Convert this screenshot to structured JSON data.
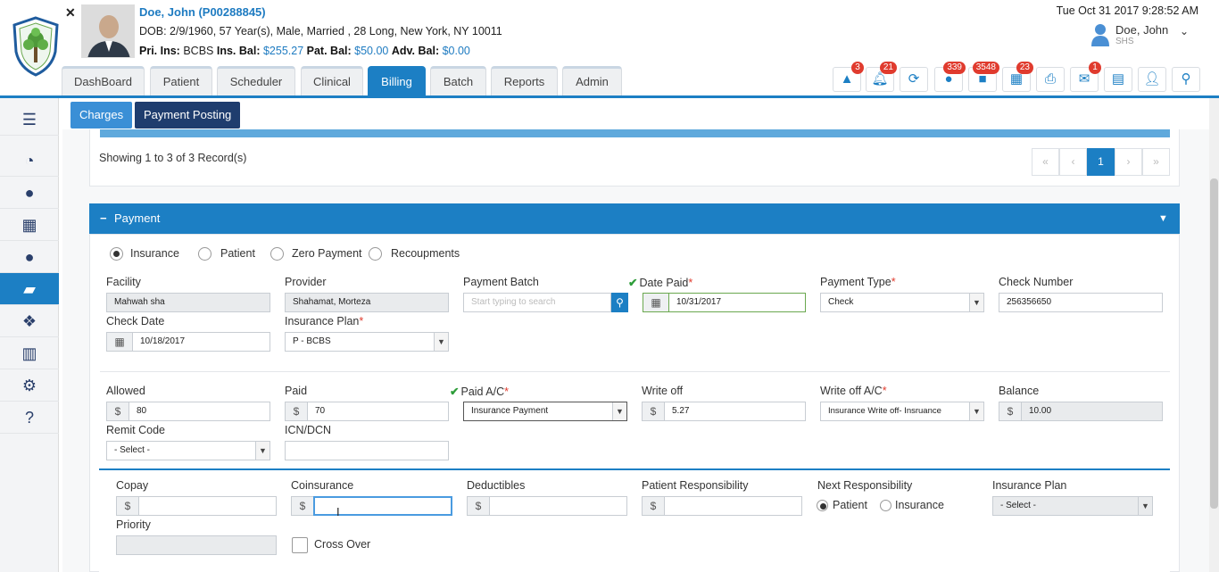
{
  "patient": {
    "name": "Doe, John (P00288845)",
    "demographics": "DOB: 2/9/1960, 57 Year(s), Male, Married , 28 Long, New York, NY 10011",
    "pri_ins_label": "Pri. Ins:",
    "pri_ins_value": "BCBS",
    "ins_bal_label": "Ins. Bal:",
    "ins_bal_value": "$255.27",
    "pat_bal_label": "Pat. Bal:",
    "pat_bal_value": "$50.00",
    "adv_bal_label": "Adv. Bal:",
    "adv_bal_value": "$0.00"
  },
  "datetime": "Tue Oct 31 2017 9:28:52 AM",
  "user": {
    "name": "Doe, John",
    "org": "SHS"
  },
  "tabs": [
    "DashBoard",
    "Patient",
    "Scheduler",
    "Clinical",
    "Billing",
    "Batch",
    "Reports",
    "Admin"
  ],
  "toolbar": {
    "badges": [
      "3",
      "21",
      "339",
      "3548",
      "23",
      "1"
    ]
  },
  "subtabs": [
    "Charges",
    "Payment Posting"
  ],
  "records": {
    "showing": "Showing 1 to 3 of 3 Record(s)",
    "current_page": "1"
  },
  "payment": {
    "section_title": "Payment",
    "payer_types": [
      "Insurance",
      "Patient",
      "Zero Payment",
      "Recoupments"
    ],
    "facility": {
      "label": "Facility",
      "value": "Mahwah sha"
    },
    "provider": {
      "label": "Provider",
      "value": "Shahamat, Morteza"
    },
    "payment_batch": {
      "label": "Payment Batch",
      "placeholder": "Start typing to search"
    },
    "date_paid": {
      "label": "Date Paid",
      "value": "10/31/2017"
    },
    "payment_type": {
      "label": "Payment Type",
      "value": "Check"
    },
    "check_number": {
      "label": "Check Number",
      "value": "256356650"
    },
    "check_date": {
      "label": "Check Date",
      "value": "10/18/2017"
    },
    "insurance_plan": {
      "label": "Insurance Plan",
      "value": "P - BCBS"
    },
    "allowed": {
      "label": "Allowed",
      "value": "80"
    },
    "paid": {
      "label": "Paid",
      "value": "70"
    },
    "paid_ac": {
      "label": "Paid A/C",
      "value": "Insurance Payment"
    },
    "write_off": {
      "label": "Write off",
      "value": "5.27"
    },
    "write_off_ac": {
      "label": "Write off A/C",
      "value": "Insurance Write off- Insruance"
    },
    "balance": {
      "label": "Balance",
      "value": "10.00"
    },
    "remit_code": {
      "label": "Remit Code",
      "value": "- Select -"
    },
    "icn_dcn": {
      "label": "ICN/DCN",
      "value": ""
    },
    "currency": "$"
  },
  "responsibility": {
    "copay": {
      "label": "Copay",
      "value": ""
    },
    "coinsurance": {
      "label": "Coinsurance",
      "value": ""
    },
    "deductibles": {
      "label": "Deductibles",
      "value": ""
    },
    "patient_responsibility": {
      "label": "Patient Responsibility",
      "value": ""
    },
    "next_responsibility": {
      "label": "Next Responsibility",
      "options": [
        "Patient",
        "Insurance"
      ]
    },
    "insurance_plan": {
      "label": "Insurance Plan",
      "value": "- Select -"
    },
    "priority": {
      "label": "Priority",
      "value": ""
    },
    "cross_over": {
      "label": "Cross Over"
    }
  },
  "colors": {
    "accent": "#1c7fc4",
    "badge": "#e03b2e",
    "dark_button": "#1f3d6e"
  }
}
